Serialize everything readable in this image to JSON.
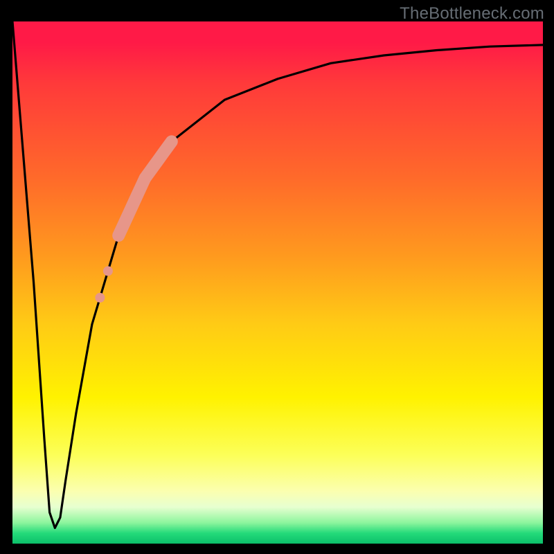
{
  "watermark": "TheBottleneck.com",
  "chart_data": {
    "type": "line",
    "title": "",
    "xlabel": "",
    "ylabel": "",
    "xlim": [
      0,
      100
    ],
    "ylim": [
      0,
      100
    ],
    "grid": false,
    "series": [
      {
        "name": "curve",
        "x": [
          0,
          2,
          4,
          6,
          7,
          8,
          9,
          10,
          12,
          15,
          20,
          25,
          30,
          40,
          50,
          60,
          70,
          80,
          90,
          100
        ],
        "y": [
          100,
          75,
          50,
          20,
          6,
          3,
          5,
          12,
          25,
          42,
          59,
          70,
          77,
          85,
          89,
          92,
          93.5,
          94.5,
          95.2,
          95.5
        ]
      }
    ],
    "highlight_segment": {
      "on_series": "curve",
      "x_start": 20,
      "x_end": 30,
      "color": "#e79689"
    },
    "annotations": []
  },
  "colors": {
    "curve": "#000000",
    "highlight": "#e79689",
    "watermark": "#666d74"
  }
}
